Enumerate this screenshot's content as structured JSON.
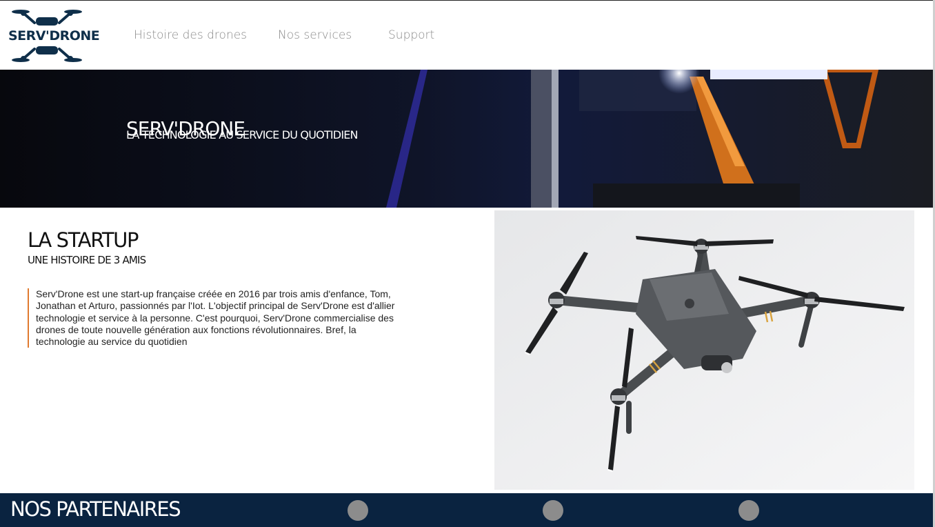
{
  "brand": {
    "logo_text": "SERV'DRONE"
  },
  "nav": {
    "items": [
      "Histoire des drones",
      "Nos services",
      "Support"
    ]
  },
  "hero": {
    "title": "SERV'DRONE",
    "subtitle": "LA TECHNOLOGIE AU SERVICE DU QUOTIDIEN"
  },
  "startup": {
    "title": "LA STARTUP",
    "subtitle": "UNE HISTOIRE DE 3 AMIS",
    "body": "Serv'Drone est une start-up française créée en 2016 par trois amis d'enfance, Tom, Jonathan et Arturo, passionnés par l'Iot. L'objectif principal de Serv'Drone est d'allier technologie et service à la personne. C'est pourquoi, Serv'Drone commercialise des drones de toute nouvelle génération aux fonctions révolutionnaires. Bref, la technologie au service du quotidien"
  },
  "partners": {
    "title": "NOS PARTENAIRES",
    "logos_count": 3
  },
  "colors": {
    "navy": "#0a2340",
    "accent": "#e07a2e",
    "nav_text": "#8a8a8a"
  }
}
